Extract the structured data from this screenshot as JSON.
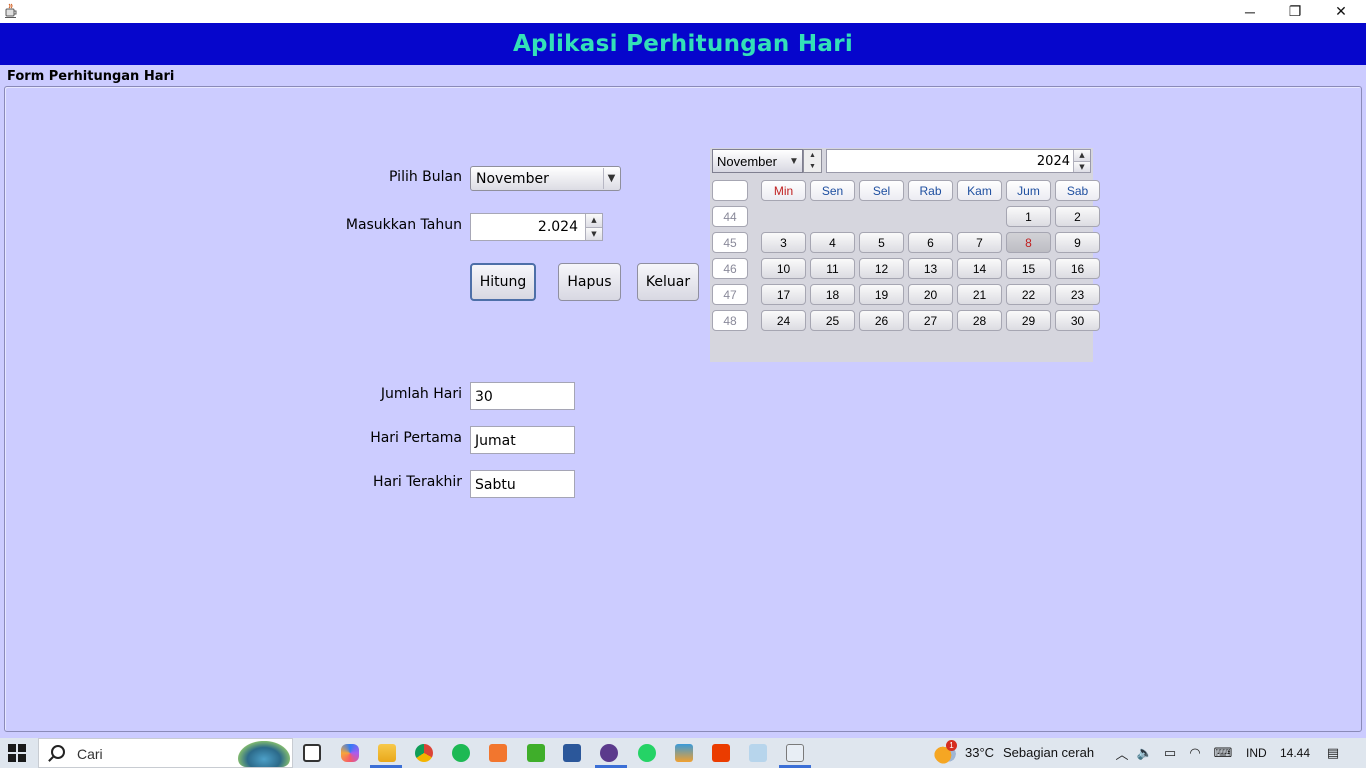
{
  "window": {
    "icon": "java-cup-icon",
    "controls": {
      "minimize": "─",
      "maximize": "❐",
      "close": "✕"
    }
  },
  "banner": {
    "title": "Aplikasi Perhitungan Hari",
    "bg_color": "#0606cc",
    "title_color": "#33e0b8"
  },
  "form": {
    "title": "Form Perhitungan Hari",
    "bg_color": "#ccccff",
    "pilih_bulan": {
      "label": "Pilih Bulan",
      "value": "November"
    },
    "masukkan_tahun": {
      "label": "Masukkan Tahun",
      "value": "2.024"
    },
    "buttons": {
      "hitung": "Hitung",
      "hapus": "Hapus",
      "keluar": "Keluar"
    },
    "jumlah_hari": {
      "label": "Jumlah Hari",
      "value": "30"
    },
    "hari_pertama": {
      "label": "Hari Pertama",
      "value": "Jumat"
    },
    "hari_terakhir": {
      "label": "Hari Terakhir",
      "value": "Sabtu"
    }
  },
  "calendar": {
    "month": "November",
    "year": "2024",
    "weekday_headers": [
      "Min",
      "Sen",
      "Sel",
      "Rab",
      "Kam",
      "Jum",
      "Sab"
    ],
    "week_numbers": [
      "44",
      "45",
      "46",
      "47",
      "48"
    ],
    "weeks": [
      [
        "",
        "",
        "",
        "",
        "",
        "1",
        "2"
      ],
      [
        "3",
        "4",
        "5",
        "6",
        "7",
        "8",
        "9"
      ],
      [
        "10",
        "11",
        "12",
        "13",
        "14",
        "15",
        "16"
      ],
      [
        "17",
        "18",
        "19",
        "20",
        "21",
        "22",
        "23"
      ],
      [
        "24",
        "25",
        "26",
        "27",
        "28",
        "29",
        "30"
      ]
    ],
    "selected_day": "8"
  },
  "taskbar": {
    "search_placeholder": "Cari",
    "weather_temp": "33°C",
    "weather_desc": "Sebagian cerah",
    "weather_badge": "1",
    "language": "IND",
    "time": "14.44",
    "pinned_apps": [
      "task-view-icon",
      "copilot-icon",
      "file-explorer-icon",
      "chrome-icon",
      "spotify-icon",
      "xampp-icon",
      "camtasia-icon",
      "word-icon",
      "obs-icon",
      "whatsapp-icon",
      "netbeans-icon",
      "office-icon",
      "notepad-icon",
      "java-icon"
    ]
  }
}
